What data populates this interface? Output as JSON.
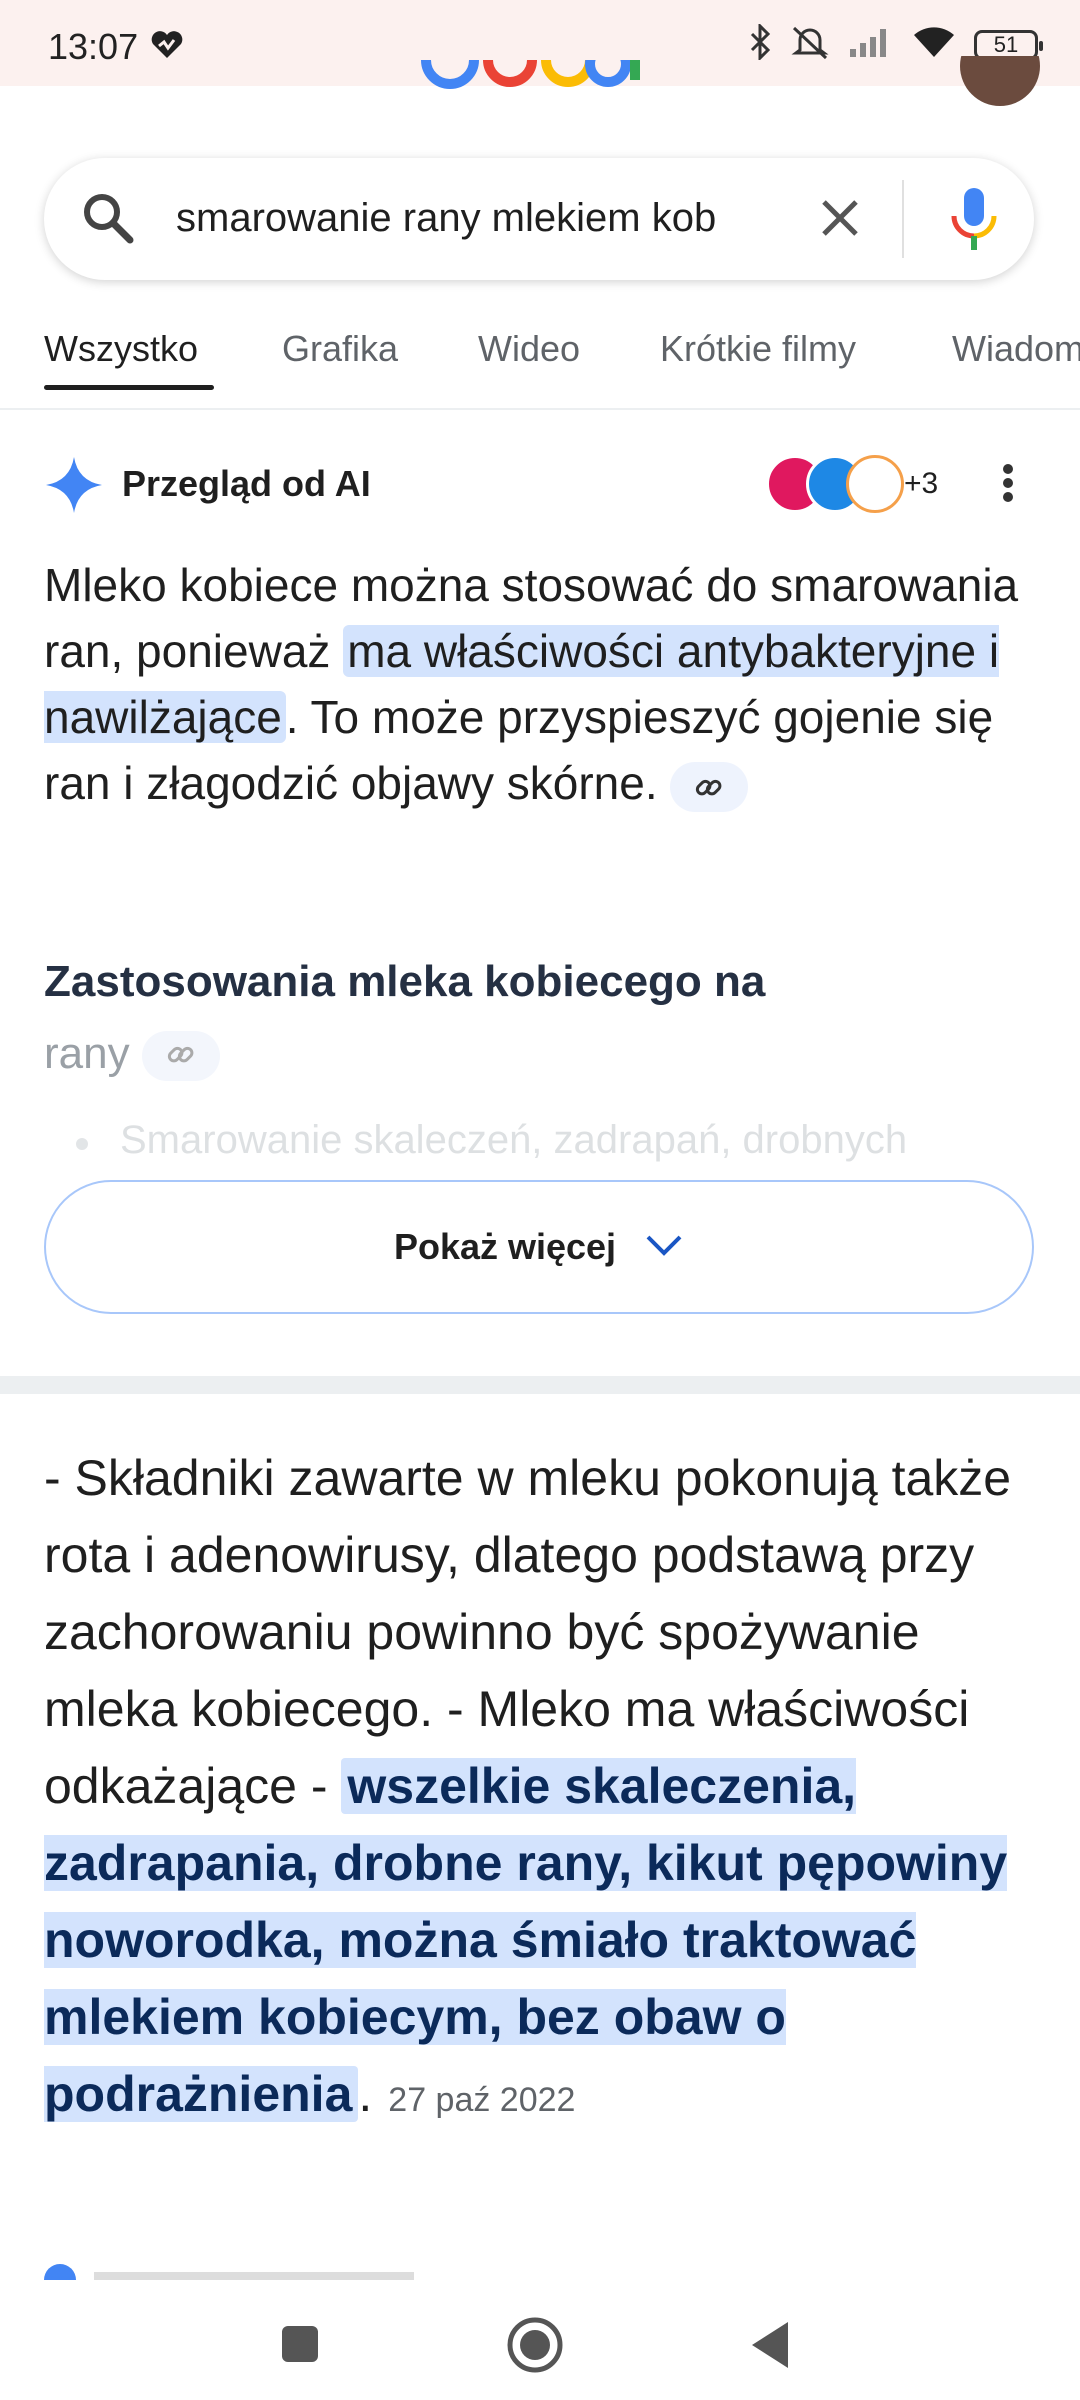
{
  "status_bar": {
    "time": "13:07",
    "battery": "51",
    "icons": [
      "heart-icon",
      "bluetooth-icon",
      "mute-icon",
      "signal-icon",
      "wifi-icon",
      "battery-icon"
    ]
  },
  "search": {
    "query": "smarowanie rany mlekiem kob"
  },
  "tabs": [
    {
      "label": "Wszystko"
    },
    {
      "label": "Grafika"
    },
    {
      "label": "Wideo"
    },
    {
      "label": "Krótkie filmy"
    },
    {
      "label": "Wiadom"
    }
  ],
  "ai_overview": {
    "title": "Przegląd od AI",
    "extra_sources": "+3",
    "body_pre": "Mleko kobiece można stosować do smarowania ran, ponieważ ",
    "body_highlight": "ma właściwości antybakteryjne i nawilżające",
    "body_post": ". To może przyspieszyć gojenie się ran i złagodzić objawy skórne.",
    "subheading_main": "Zastosowania mleka kobiecego na",
    "subheading_fade": "rany",
    "bullet_faded": "Smarowanie skaleczeń, zadrapań, drobnych",
    "show_more": "Pokaż więcej",
    "colors": {
      "highlight": "#d3e3fd",
      "accent": "#4285f4"
    }
  },
  "snippet": {
    "text_pre": "- Składniki zawarte w mleku pokonują także rota i adenowirusy, dlatego podstawą przy zachorowaniu powinno być spożywanie mleka kobiecego. - Mleko ma właściwości odkażające - ",
    "text_highlight": "wszelkie skaleczenia, zadrapania, drobne rany, kikut pępowiny noworodka, można śmiało traktować mlekiem kobiecym, bez obaw o podrażnienia",
    "text_post": ".",
    "date": "27 paź 2022"
  },
  "nav": {
    "icons": [
      "recents-icon",
      "home-icon",
      "back-icon"
    ]
  }
}
